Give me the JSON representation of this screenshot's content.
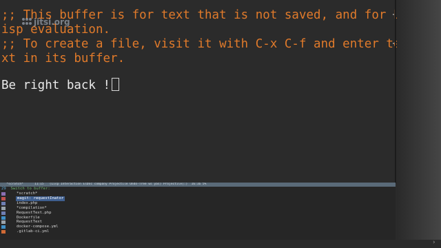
{
  "buffer": {
    "lines": [
      ";; This buffer is for text that is not saved, and for L",
      "isp evaluation.",
      ";; To create a file, visit it with C-x C-f and enter te",
      "xt in its buffer."
    ],
    "text": "Be right back !"
  },
  "watermark": {
    "text": "jitsi.org"
  },
  "modeline": {
    "text": "  *scratch*      11:15   (Lisp Interaction ElDoc company Projectile Undo-Tree ws yas) Projectile[:)  16:16 5%"
  },
  "minibuffer": {
    "count": "29",
    "prompt": "Switch to buffer:",
    "candidates": [
      {
        "label": "*scratch*",
        "icon": "emacs-icon",
        "icon_color": "#8a6fb3"
      },
      {
        "label": "magit: requestInator",
        "icon": "magit-icon",
        "icon_color": "#c0504d",
        "selected": true
      },
      {
        "label": "index.php",
        "icon": "php-icon",
        "icon_color": "#6f7fb3"
      },
      {
        "label": "*compilation*",
        "icon": "gear-icon",
        "icon_color": "#9aa3aa"
      },
      {
        "label": "RequestText.php",
        "icon": "php-icon",
        "icon_color": "#6f7fb3"
      },
      {
        "label": "Dockerfile",
        "icon": "docker-icon",
        "icon_color": "#3f8fc6"
      },
      {
        "label": "RequestText",
        "icon": "settings-icon",
        "icon_color": "#9aa3aa"
      },
      {
        "label": "docker-compose.yml",
        "icon": "docker-icon",
        "icon_color": "#3f8fc6"
      },
      {
        "label": ".gitlab-ci.yml",
        "icon": "gitlab-icon",
        "icon_color": "#d06a35"
      }
    ]
  },
  "chevron": {
    "glyph": "›"
  }
}
